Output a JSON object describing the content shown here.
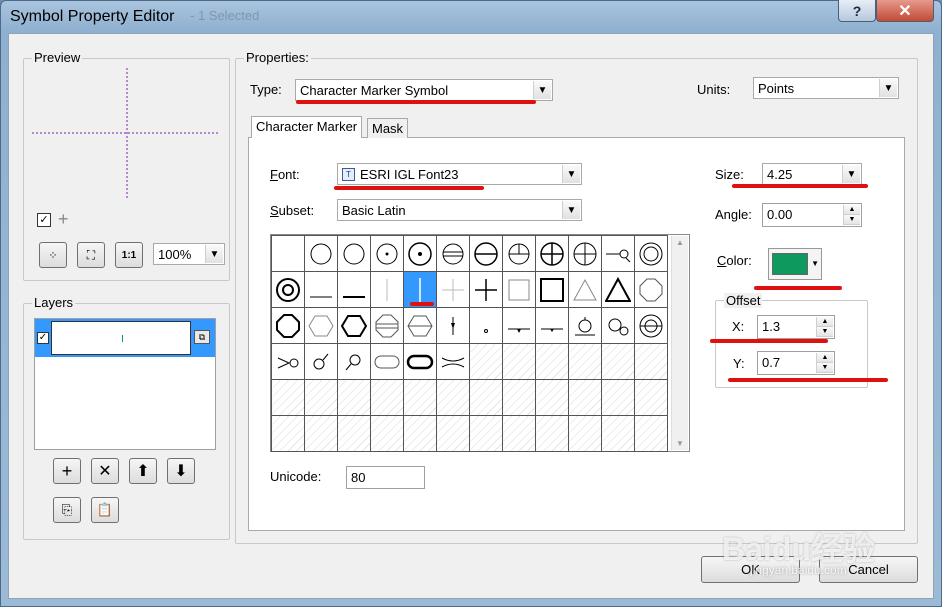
{
  "window": {
    "title": "Symbol Property Editor",
    "ghost_title": "- 1 Selected"
  },
  "titlebar": {
    "help_glyph": "?",
    "close_glyph": "✕"
  },
  "preview": {
    "legend": "Preview",
    "checkbox_checked": true,
    "zoom_value": "100%"
  },
  "layers": {
    "legend": "Layers",
    "items": [
      {
        "checked": true,
        "selected": true
      }
    ]
  },
  "properties": {
    "legend": "Properties:",
    "type_label": "Type:",
    "type_value": "Character Marker Symbol",
    "units_label": "Units:",
    "units_value": "Points"
  },
  "tabs": [
    {
      "label": "Character Marker",
      "active": true
    },
    {
      "label": "Mask",
      "active": false
    }
  ],
  "character_marker": {
    "font_label": "Font:",
    "font_value": "ESRI IGL Font23",
    "subset_label": "Subset:",
    "subset_value": "Basic Latin",
    "unicode_label": "Unicode:",
    "unicode_value": "80",
    "size_label": "Size:",
    "size_value": "4.25",
    "angle_label": "Angle:",
    "angle_value": "0.00",
    "color_label": "Color:",
    "color_hex": "#0e9a5e",
    "offset_legend": "Offset",
    "x_label": "X:",
    "x_value": "1.3",
    "y_label": "Y:",
    "y_value": "0.7",
    "selected_glyph": "vertical-line"
  },
  "buttons": {
    "ok": "OK",
    "cancel": "Cancel"
  },
  "watermark": {
    "brand": "Baidu经验",
    "url": "jingyan.baidu.com"
  },
  "colors": {
    "accent": "#3399ff",
    "annotation": "#e01010",
    "title_bar": "#a9c4de"
  }
}
